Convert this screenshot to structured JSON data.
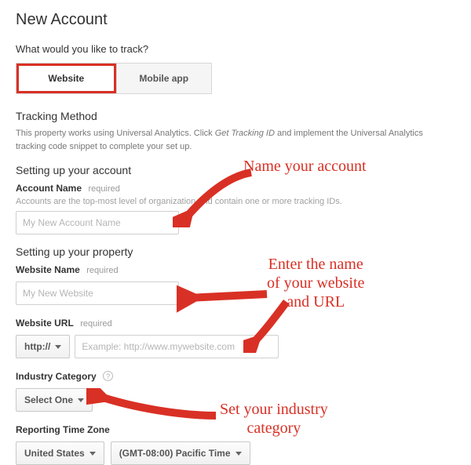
{
  "page": {
    "title": "New Account",
    "question": "What would you like to track?",
    "tabs": {
      "website": "Website",
      "mobile": "Mobile app"
    }
  },
  "tracking": {
    "heading": "Tracking Method",
    "desc_a": "This property works using Universal Analytics. Click ",
    "desc_em": "Get Tracking ID",
    "desc_b": " and implement the Universal Analytics tracking code snippet to complete your set up."
  },
  "account": {
    "heading": "Setting up your account",
    "name_label": "Account Name",
    "required": "required",
    "help": "Accounts are the top-most level of organization and contain one or more tracking IDs.",
    "placeholder": "My New Account Name"
  },
  "property": {
    "heading": "Setting up your property",
    "name_label": "Website Name",
    "name_placeholder": "My New Website",
    "url_label": "Website URL",
    "protocol": "http://",
    "url_placeholder": "Example: http://www.mywebsite.com"
  },
  "industry": {
    "label": "Industry Category",
    "select": "Select One"
  },
  "timezone": {
    "label": "Reporting Time Zone",
    "country": "United States",
    "zone": "(GMT-08:00) Pacific Time"
  },
  "annotations": {
    "a1": "Name your account",
    "a2": "Enter the name\nof your website\nand URL",
    "a3": "Set your industry\ncategory"
  }
}
